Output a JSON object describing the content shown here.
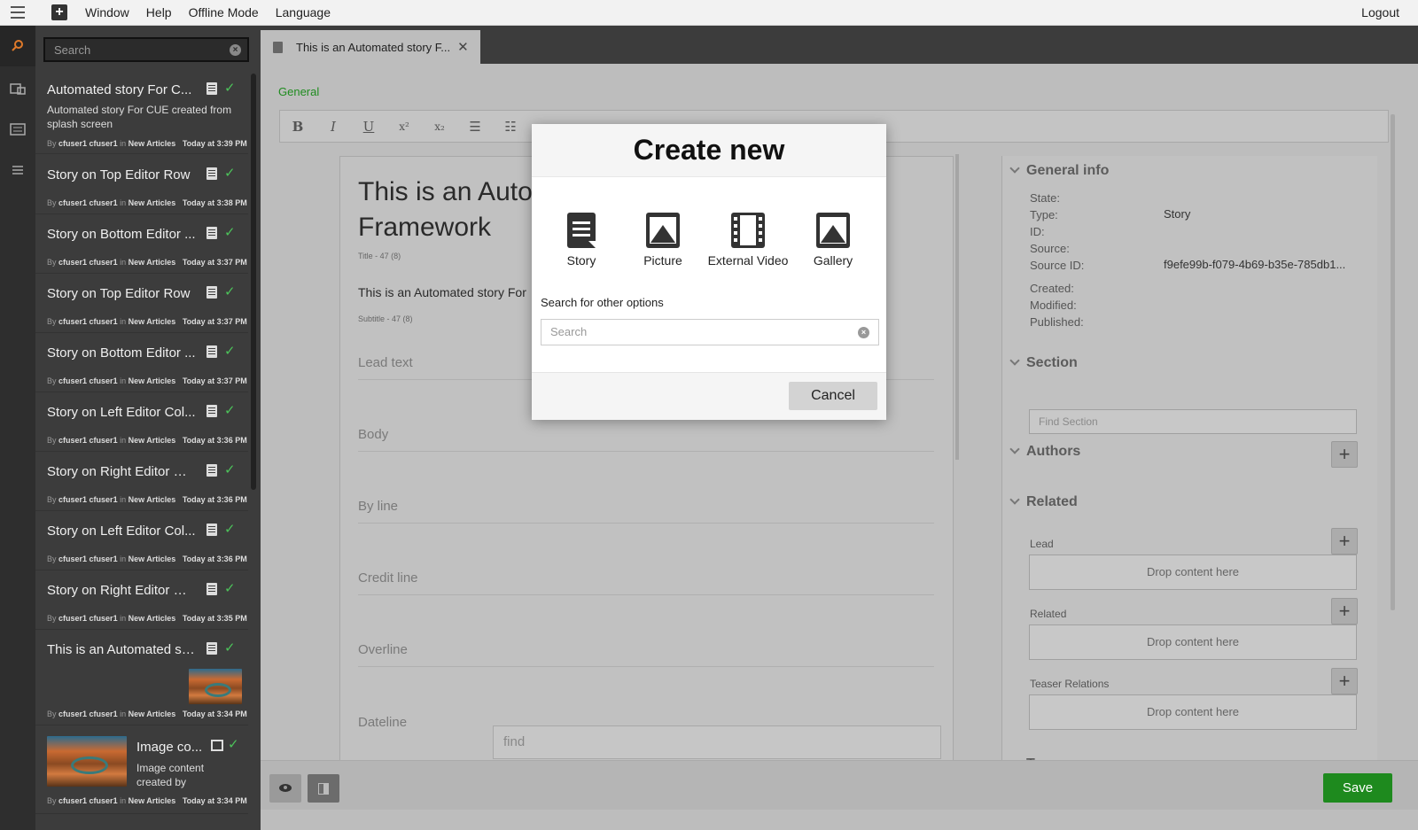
{
  "menu": {
    "items": [
      "Window",
      "Help",
      "Offline Mode",
      "Language"
    ],
    "logout": "Logout"
  },
  "list": {
    "search_placeholder": "Search",
    "items": [
      {
        "title": "Automated story For C...",
        "desc": "Automated story For CUE created from splash screen",
        "user": "cfuser1 cfuser1",
        "section": "New Articles",
        "time": "Today at 3:39 PM"
      },
      {
        "title": "Story on Top Editor Row",
        "desc": "",
        "user": "cfuser1 cfuser1",
        "section": "New Articles",
        "time": "Today at 3:38 PM"
      },
      {
        "title": "Story on Bottom Editor ...",
        "desc": "",
        "user": "cfuser1 cfuser1",
        "section": "New Articles",
        "time": "Today at 3:37 PM"
      },
      {
        "title": "Story on Top Editor Row",
        "desc": "",
        "user": "cfuser1 cfuser1",
        "section": "New Articles",
        "time": "Today at 3:37 PM"
      },
      {
        "title": "Story on Bottom Editor ...",
        "desc": "",
        "user": "cfuser1 cfuser1",
        "section": "New Articles",
        "time": "Today at 3:37 PM"
      },
      {
        "title": "Story on Left Editor Col...",
        "desc": "",
        "user": "cfuser1 cfuser1",
        "section": "New Articles",
        "time": "Today at 3:36 PM"
      },
      {
        "title": "Story on Right Editor Co...",
        "desc": "",
        "user": "cfuser1 cfuser1",
        "section": "New Articles",
        "time": "Today at 3:36 PM"
      },
      {
        "title": "Story on Left Editor Col...",
        "desc": "",
        "user": "cfuser1 cfuser1",
        "section": "New Articles",
        "time": "Today at 3:36 PM"
      },
      {
        "title": "Story on Right Editor Co...",
        "desc": "",
        "user": "cfuser1 cfuser1",
        "section": "New Articles",
        "time": "Today at 3:35 PM"
      },
      {
        "title": "This is an Automated st...",
        "desc": "",
        "user": "cfuser1 cfuser1",
        "section": "New Articles",
        "time": "Today at 3:34 PM"
      },
      {
        "title": "Image co...",
        "desc": "Image content created by",
        "user": "cfuser1 cfuser1",
        "section": "New Articles",
        "time": "Today at 3:34 PM"
      }
    ],
    "by": "By",
    "in": "in"
  },
  "tab": {
    "label": "This is an Automated story F..."
  },
  "editor": {
    "general": "General",
    "toolbar": [
      "B",
      "I",
      "U",
      "x²",
      "x₂",
      "☰",
      "☷"
    ],
    "title_text": "This is an Autom⁠ated Story for Web Framework",
    "title_line1": "This is an Auton",
    "title_line2": "Framework",
    "title_meta": "Title - 47 (8)",
    "subtitle": "This is an Automated story For",
    "subtitle_meta": "Subtitle - 47 (8)",
    "fields": [
      "Lead text",
      "Body",
      "By line",
      "Credit line",
      "Overline",
      "Dateline"
    ],
    "dateline_placeholder": "find"
  },
  "side": {
    "general_info": "General info",
    "state_label": "State:",
    "type_label": "Type:",
    "type_value": "Story",
    "id_label": "ID:",
    "source_label": "Source:",
    "source_id_label": "Source ID:",
    "source_id_value": "f9efe99b-f079-4b69-b35e-785db1...",
    "created_label": "Created:",
    "modified_label": "Modified:",
    "published_label": "Published:",
    "section": "Section",
    "find_section": "Find Section",
    "authors": "Authors",
    "related": "Related",
    "lead": "Lead",
    "related_sub": "Related",
    "teaser": "Teaser Relations",
    "drop": "Drop content here",
    "tags": "Tags"
  },
  "bottom": {
    "save": "Save"
  },
  "modal": {
    "title": "Create new",
    "types": [
      "Story",
      "Picture",
      "External Video",
      "Gallery"
    ],
    "search_label": "Search for other options",
    "search_placeholder": "Search",
    "cancel": "Cancel"
  },
  "colors": {
    "accent_green": "#1e8a1e",
    "check_green": "#4cc25a"
  }
}
